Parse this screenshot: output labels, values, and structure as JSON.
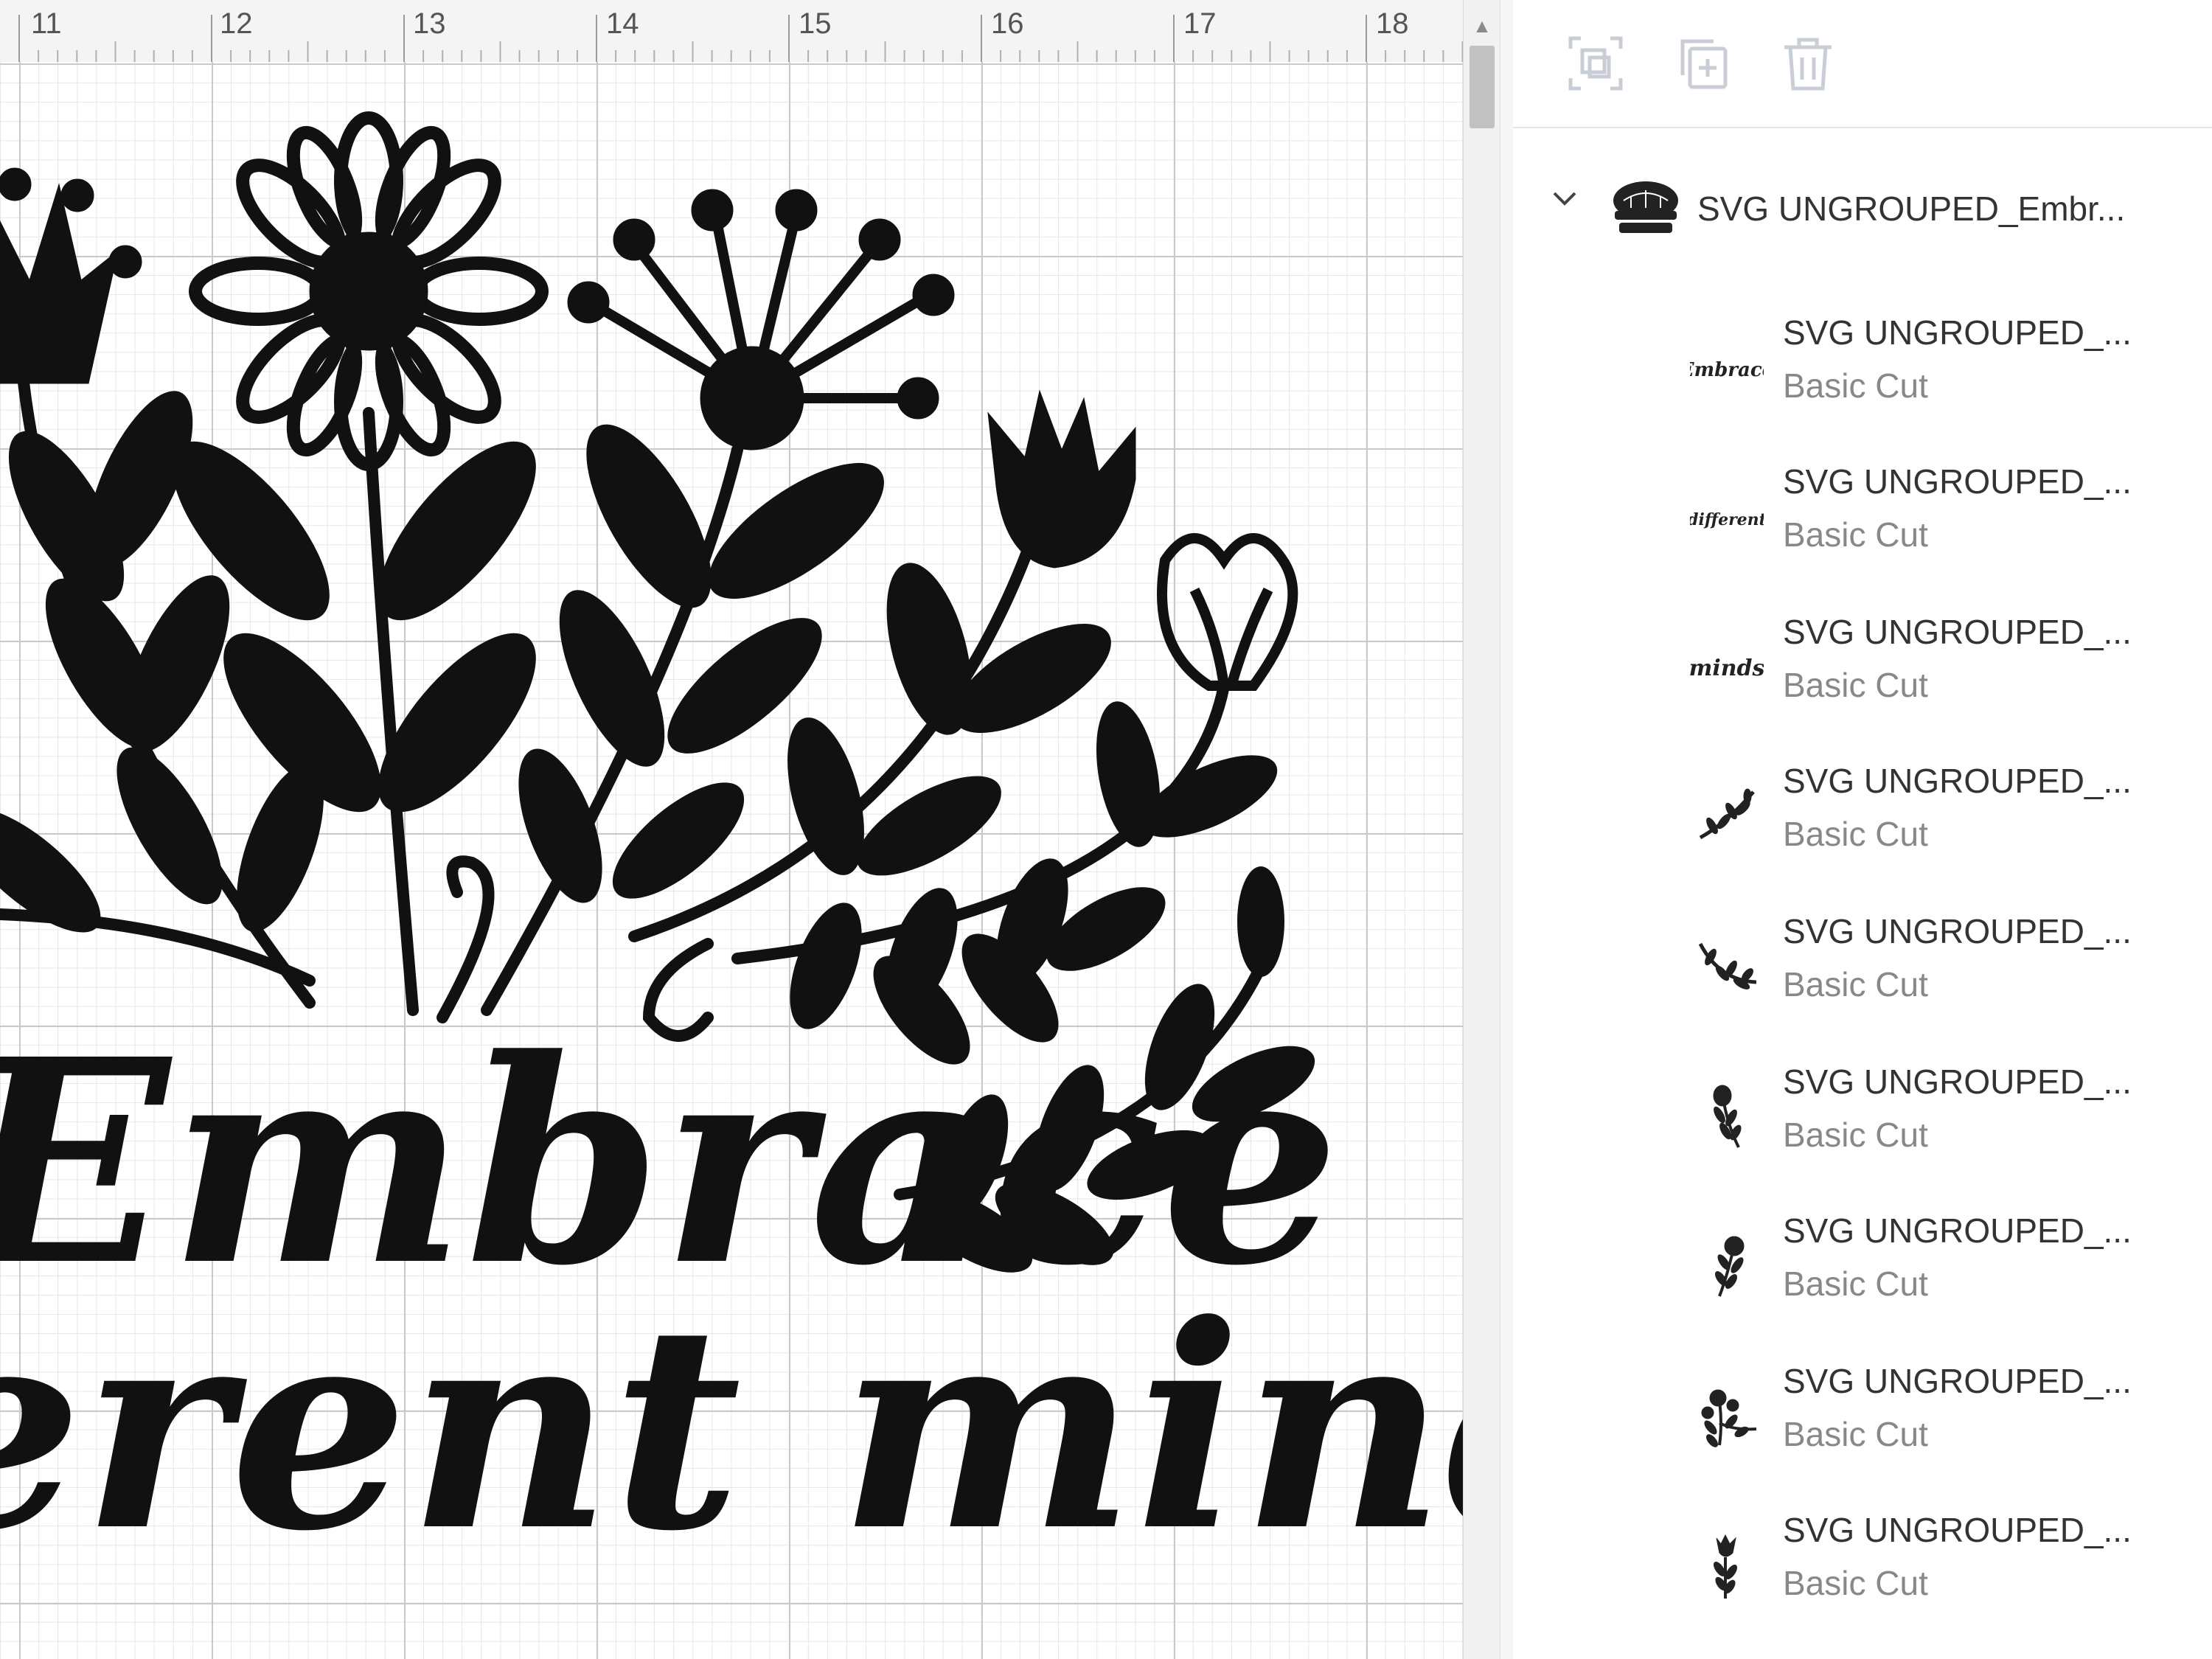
{
  "ruler": {
    "labels": [
      "11",
      "12",
      "13",
      "14",
      "15",
      "16",
      "17",
      "18"
    ]
  },
  "canvas": {
    "text_line_1": "Embrace",
    "text_line_2": "erent minds"
  },
  "toolbar": {
    "buttons": [
      {
        "name": "group-icon",
        "enabled": false
      },
      {
        "name": "duplicate-icon",
        "enabled": false
      },
      {
        "name": "trash-icon",
        "enabled": false
      }
    ]
  },
  "layers": {
    "group": {
      "title": "SVG UNGROUPED_Embr...",
      "expanded": true,
      "thumb_icon": "flower-bouquet-icon"
    },
    "items": [
      {
        "name": "SVG UNGROUPED_...",
        "type": "Basic Cut",
        "thumb_icon": "text-embrace-thumbnail",
        "thumb_text": "Embrace"
      },
      {
        "name": "SVG UNGROUPED_...",
        "type": "Basic Cut",
        "thumb_icon": "text-different-thumbnail",
        "thumb_text": "different"
      },
      {
        "name": "SVG UNGROUPED_...",
        "type": "Basic Cut",
        "thumb_icon": "text-minds-thumbnail",
        "thumb_text": "minds"
      },
      {
        "name": "SVG UNGROUPED_...",
        "type": "Basic Cut",
        "thumb_icon": "branch-icon"
      },
      {
        "name": "SVG UNGROUPED_...",
        "type": "Basic Cut",
        "thumb_icon": "branch-icon"
      },
      {
        "name": "SVG UNGROUPED_...",
        "type": "Basic Cut",
        "thumb_icon": "flower-stem-icon"
      },
      {
        "name": "SVG UNGROUPED_...",
        "type": "Basic Cut",
        "thumb_icon": "flower-stem-icon"
      },
      {
        "name": "SVG UNGROUPED_...",
        "type": "Basic Cut",
        "thumb_icon": "flower-cluster-icon"
      },
      {
        "name": "SVG UNGROUPED_...",
        "type": "Basic Cut",
        "thumb_icon": "tulip-icon"
      }
    ]
  }
}
